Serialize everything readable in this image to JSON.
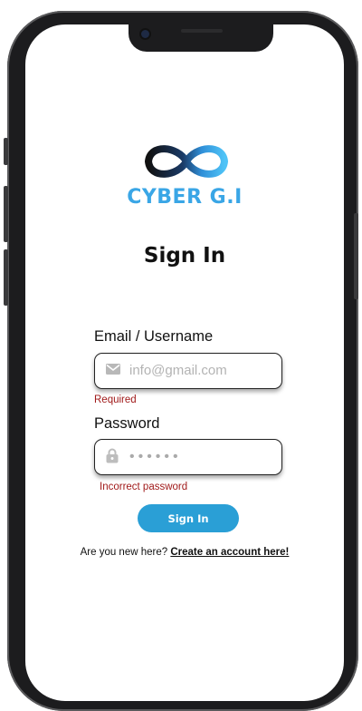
{
  "brand": {
    "name": "CYBER G.I",
    "color": "#3aa6e6",
    "logo_icon": "infinity-icon"
  },
  "page": {
    "title": "Sign In"
  },
  "form": {
    "email": {
      "label": "Email / Username",
      "placeholder": "info@gmail.com",
      "icon": "envelope-icon",
      "error": "Required"
    },
    "password": {
      "label": "Password",
      "value": "••••••",
      "icon": "lock-icon",
      "error": "Incorrect password"
    },
    "submit_label": "Sign In",
    "submit_color": "#2a9fd6",
    "error_color": "#a01a1a"
  },
  "signup": {
    "prompt": "Are you new here?",
    "link_text": "Create an account here!"
  }
}
